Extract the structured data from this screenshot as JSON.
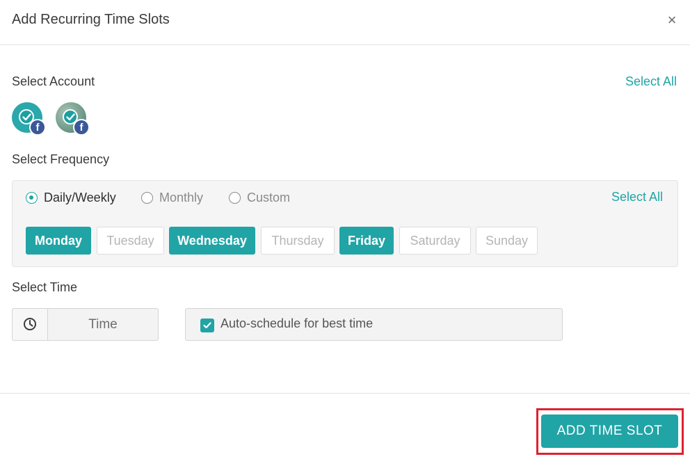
{
  "dialog": {
    "title": "Add Recurring Time Slots",
    "close_label": "×"
  },
  "account": {
    "label": "Select Account",
    "select_all": "Select All",
    "accounts": [
      {
        "network": "facebook",
        "network_glyph": "f",
        "selected": true,
        "avatar_color": "#2aa8ab"
      },
      {
        "network": "facebook",
        "network_glyph": "f",
        "selected": true,
        "avatar_color": "#7fa99a"
      }
    ]
  },
  "frequency": {
    "label": "Select Frequency",
    "select_all": "Select All",
    "options": [
      {
        "label": "Daily/Weekly",
        "selected": true
      },
      {
        "label": "Monthly",
        "selected": false
      },
      {
        "label": "Custom",
        "selected": false
      }
    ],
    "days": [
      {
        "label": "Monday",
        "active": true
      },
      {
        "label": "Tuesday",
        "active": false
      },
      {
        "label": "Wednesday",
        "active": true
      },
      {
        "label": "Thursday",
        "active": false
      },
      {
        "label": "Friday",
        "active": true
      },
      {
        "label": "Saturday",
        "active": false
      },
      {
        "label": "Sunday",
        "active": false
      }
    ]
  },
  "time": {
    "label": "Select Time",
    "placeholder": "Time",
    "icon": "clock-icon",
    "auto_schedule_label": "Auto-schedule for best time",
    "auto_schedule_checked": true
  },
  "footer": {
    "add_button": "ADD TIME SLOT"
  },
  "colors": {
    "accent": "#21a4a6",
    "highlight": "#e02030",
    "facebook": "#3b5998"
  }
}
